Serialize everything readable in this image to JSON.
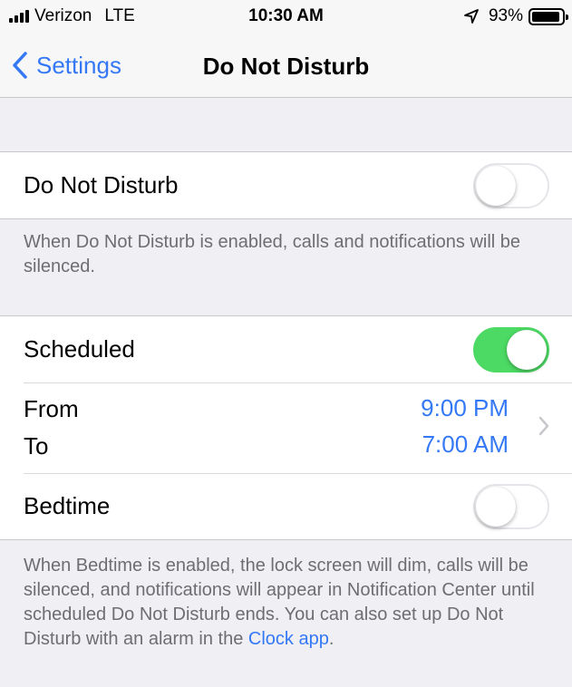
{
  "status_bar": {
    "carrier": "Verizon",
    "network": "LTE",
    "time": "10:30 AM",
    "battery": "93%",
    "battery_level": 0.93,
    "icons": [
      "signal-icon",
      "location-arrow-icon",
      "battery-icon"
    ]
  },
  "nav": {
    "back_label": "Settings",
    "title": "Do Not Disturb"
  },
  "dnd": {
    "label": "Do Not Disturb",
    "enabled": false,
    "footer": "When Do Not Disturb is enabled, calls and notifications will be silenced."
  },
  "schedule": {
    "scheduled_label": "Scheduled",
    "scheduled_enabled": true,
    "from_label": "From",
    "to_label": "To",
    "from_time": "9:00 PM",
    "to_time": "7:00 AM",
    "bedtime_label": "Bedtime",
    "bedtime_enabled": false,
    "footer": "When Bedtime is enabled, the lock screen will dim, calls will be silenced, and notifications will appear in Notification Center until scheduled Do Not Disturb ends. You can also set up Do Not Disturb with an alarm in the ",
    "footer_link": "Clock app",
    "footer_end": "."
  },
  "colors": {
    "accent": "#3478f6",
    "toggle_on": "#4cd964",
    "background": "#efeff4",
    "secondary_text": "#6d6d72"
  }
}
